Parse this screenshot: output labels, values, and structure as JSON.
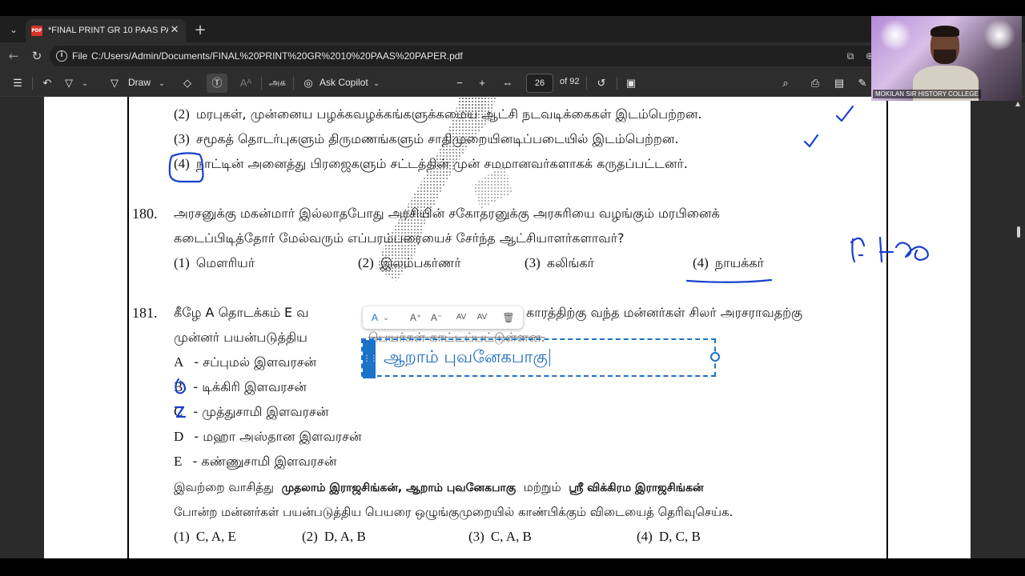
{
  "browser": {
    "tab_title": "*FINAL PRINT GR 10 PAAS PAPER.p",
    "file_label": "File",
    "url": "C:/Users/Admin/Documents/FINAL%20PRINT%20GR%2010%20PAAS%20PAPER.pdf"
  },
  "pdf_toolbar": {
    "draw_label": "Draw",
    "tamil_read_label": "அக",
    "copilot_label": "Ask Copilot",
    "page_number": "26",
    "page_total": "of 92"
  },
  "document": {
    "q179_options": [
      {
        "num": "(2)",
        "text": "மரபுகள், முன்னைய பழக்கவழக்கங்களுக்கமைய ஆட்சி நடவடிக்கைகள் இடம்பெற்றன."
      },
      {
        "num": "(3)",
        "text": "சமூகத் தொடர்புகளும் திருமணங்களும் சாதிமுறையினடிப்படையில் இடம்பெற்றன."
      },
      {
        "num": "(4)",
        "text": "நாட்டின் அனைத்து பிரஜைகளும் சட்டத்தின் முன் சமமானவர்களாகக் கருதப்பட்டனர்."
      }
    ],
    "q180": {
      "number": "180.",
      "line1": "அரசனுக்கு மகன்மார் இல்லாதபோது அரசியின் சகோதரனுக்கு அரசுரியை வழங்கும் மரபினைக்",
      "line2": "கடைப்பிடித்தோர் மேல்வரும் எப்பரம்பரையைச் சேர்ந்த ஆட்சியாளர்களாவர்?",
      "options": [
        {
          "num": "(1)",
          "text": "மௌரியர்"
        },
        {
          "num": "(2)",
          "text": "இலம்பகர்ணர்"
        },
        {
          "num": "(3)",
          "text": "கலிங்கர்"
        },
        {
          "num": "(4)",
          "text": "நாயக்கர்"
        }
      ]
    },
    "q181": {
      "number": "181.",
      "line1_part1": "கீழே A தொடக்கம் E வ",
      "line1_part2": "காரத்திற்கு வந்த மன்னர்கள் சிலர் அரசராவதற்கு",
      "line2_part1": "முன்னர் பயன்படுத்திய",
      "line2_part2": "பெயர்கள் காட்டப்பட்டுள்ளன.",
      "items": [
        {
          "letter": "A",
          "text": "சப்புமல் இளவரசன்"
        },
        {
          "letter": "B",
          "text": "டிக்கிரி இளவரசன்"
        },
        {
          "letter": "C",
          "text": "முத்துசாமி இளவரசன்"
        },
        {
          "letter": "D",
          "text": "மஹா அஸ்தான இளவரசன்"
        },
        {
          "letter": "E",
          "text": "கண்ணுசாமி இளவரசன்"
        }
      ],
      "read_prefix": "இவற்றை வாசித்து",
      "bold_names": "முதலாம் இராஜசிங்கன், ஆறாம் புவனேகபாகு",
      "and_word": "மற்றும்",
      "bold_last": "ஸ்ரீ விக்கிரம இராஜசிங்கன்",
      "line_last": "போன்ற மன்னர்கள் பயன்படுத்திய பெயரை ஒழுங்குமுறையில் காண்பிக்கும் விடையைத் தெரிவுசெய்க.",
      "options": [
        {
          "num": "(1)",
          "text": "C, A, E"
        },
        {
          "num": "(2)",
          "text": "D, A, B"
        },
        {
          "num": "(3)",
          "text": "C,  A, B"
        },
        {
          "num": "(4)",
          "text": "D,  C, B"
        }
      ]
    }
  },
  "annotation": {
    "text": "ஆறாம் புவனேகபாகு",
    "color": "#1a6cc0"
  },
  "handwriting": {
    "color": "#1a3fd0"
  },
  "webcam": {
    "caption": "MOKILAN SIR HISTORY COLLEGE"
  }
}
